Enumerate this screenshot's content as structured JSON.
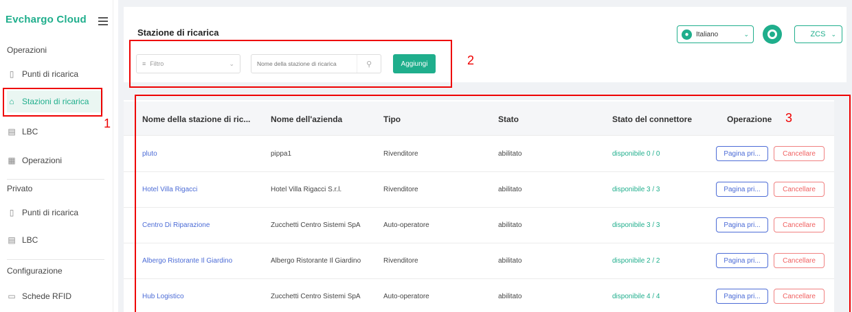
{
  "brand": {
    "logo": "Evchargo Cloud",
    "accent": "#1fae8c"
  },
  "sidebar": {
    "sections": [
      {
        "title": "Operazioni"
      },
      {
        "title": "Privato"
      },
      {
        "title": "Configurazione"
      }
    ],
    "items": [
      {
        "label": "Punti di ricarica",
        "icon": "charger-icon"
      },
      {
        "label": "Stazioni di ricarica",
        "icon": "home-icon",
        "active": true
      },
      {
        "label": "LBC",
        "icon": "lbc-icon"
      },
      {
        "label": "Operazioni",
        "icon": "operations-icon"
      },
      {
        "label": "Punti di ricarica",
        "icon": "charger-icon"
      },
      {
        "label": "LBC",
        "icon": "lbc-icon"
      },
      {
        "label": "Schede RFID",
        "icon": "card-icon"
      }
    ]
  },
  "header": {
    "title": "Stazione di ricarica",
    "language": "Italiano",
    "user": "ZCS"
  },
  "toolbar": {
    "filter_placeholder": "Filtro",
    "search_placeholder": "Nome della stazione di ricarica",
    "add_label": "Aggiungi"
  },
  "table": {
    "columns": [
      "Nome della stazione di ric...",
      "Nome dell'azienda",
      "Tipo",
      "Stato",
      "Stato del connettore",
      "Operazione"
    ],
    "rows": [
      {
        "name": "pluto",
        "company": "pippa1",
        "type": "Rivenditore",
        "status": "abilitato",
        "connector": "disponibile  0 / 0"
      },
      {
        "name": "Hotel Villa Rigacci",
        "company": "Hotel Villa Rigacci S.r.l.",
        "type": "Rivenditore",
        "status": "abilitato",
        "connector": "disponibile  3 / 3"
      },
      {
        "name": "Centro Di Riparazione",
        "company": "Zucchetti Centro Sistemi SpA",
        "type": "Auto-operatore",
        "status": "abilitato",
        "connector": "disponibile  3 / 3"
      },
      {
        "name": "Albergo Ristorante Il Giardino",
        "company": "Albergo Ristorante Il Giardino",
        "type": "Rivenditore",
        "status": "abilitato",
        "connector": "disponibile  2 / 2"
      },
      {
        "name": "Hub Logistico",
        "company": "Zucchetti Centro Sistemi SpA",
        "type": "Auto-operatore",
        "status": "abilitato",
        "connector": "disponibile  4 / 4"
      }
    ],
    "open_label": "Pagina pri...",
    "delete_label": "Cancellare"
  },
  "annotations": [
    "1",
    "2",
    "3"
  ]
}
